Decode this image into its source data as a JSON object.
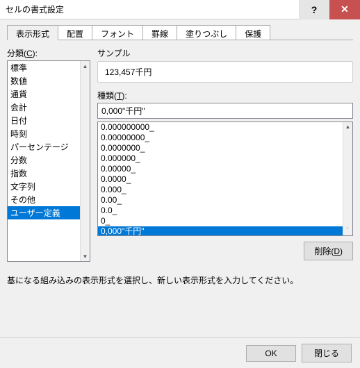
{
  "window": {
    "title": "セルの書式設定"
  },
  "tabs": [
    {
      "label": "表示形式",
      "active": true
    },
    {
      "label": "配置"
    },
    {
      "label": "フォント"
    },
    {
      "label": "罫線"
    },
    {
      "label": "塗りつぶし"
    },
    {
      "label": "保護"
    }
  ],
  "category": {
    "label_prefix": "分類(",
    "label_key": "C",
    "label_suffix": "):",
    "items": [
      "標準",
      "数値",
      "通貨",
      "会計",
      "日付",
      "時刻",
      "パーセンテージ",
      "分数",
      "指数",
      "文字列",
      "その他",
      "ユーザー定義"
    ],
    "selected": "ユーザー定義"
  },
  "sample": {
    "label": "サンプル",
    "value": "123,457千円"
  },
  "type": {
    "label_prefix": "種類(",
    "label_key": "T",
    "label_suffix": "):",
    "input_value": "0,000\"千円\"",
    "items": [
      "0.000000000_",
      "0.00000000_",
      "0.0000000_",
      "0.000000_",
      "0.00000_",
      "0.0000_",
      "0.000_",
      "0.00_",
      "0.0_",
      "0_",
      "0,000\"千円\""
    ],
    "selected": "0,000\"千円\""
  },
  "delete": {
    "prefix": "削除(",
    "key": "D",
    "suffix": ")"
  },
  "hint": "基になる組み込みの表示形式を選択し、新しい表示形式を入力してください。",
  "footer": {
    "ok": "OK",
    "close": "閉じる"
  }
}
